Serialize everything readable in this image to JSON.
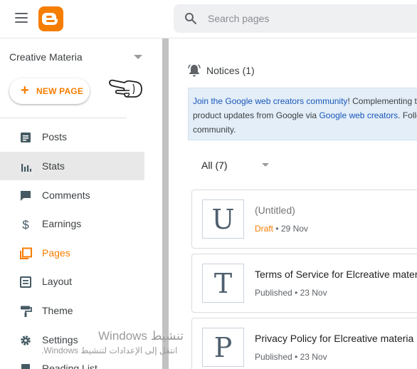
{
  "header": {
    "search_placeholder": "Search pages"
  },
  "sidebar": {
    "blog_name": "Creative Materia",
    "new_page_label": "NEW PAGE",
    "items": [
      {
        "label": "Posts"
      },
      {
        "label": "Stats"
      },
      {
        "label": "Comments"
      },
      {
        "label": "Earnings"
      },
      {
        "label": "Pages"
      },
      {
        "label": "Layout"
      },
      {
        "label": "Theme"
      },
      {
        "label": "Settings"
      },
      {
        "label": "Reading List"
      }
    ]
  },
  "watermark": {
    "line1": "Windows تنشيط",
    "line2": "انتقل إلى الإعدادات لتنشيط Windows."
  },
  "main": {
    "notices_label": "Notices (1)",
    "banner": {
      "link1": "Join the Google web creators community",
      "text1": "! Complementing th",
      "text2": "product updates from Google via ",
      "link2": "Google web creators",
      "text3": ". Follo",
      "text4": "community."
    },
    "filter_label": "All (7)",
    "pages": [
      {
        "letter": "U",
        "title": "(Untitled)",
        "status": "Draft",
        "date": " • 29 Nov"
      },
      {
        "letter": "T",
        "title": "Terms of Service for Elcreative mater",
        "status": "Published",
        "date": " • 23 Nov"
      },
      {
        "letter": "P",
        "title": "Privacy Policy for Elcreative materia",
        "status": "Published",
        "date": " • 23 Nov"
      }
    ]
  },
  "colors": {
    "accent": "#f57d00",
    "link": "#1a57b9",
    "banner_bg": "#e3eef9"
  }
}
